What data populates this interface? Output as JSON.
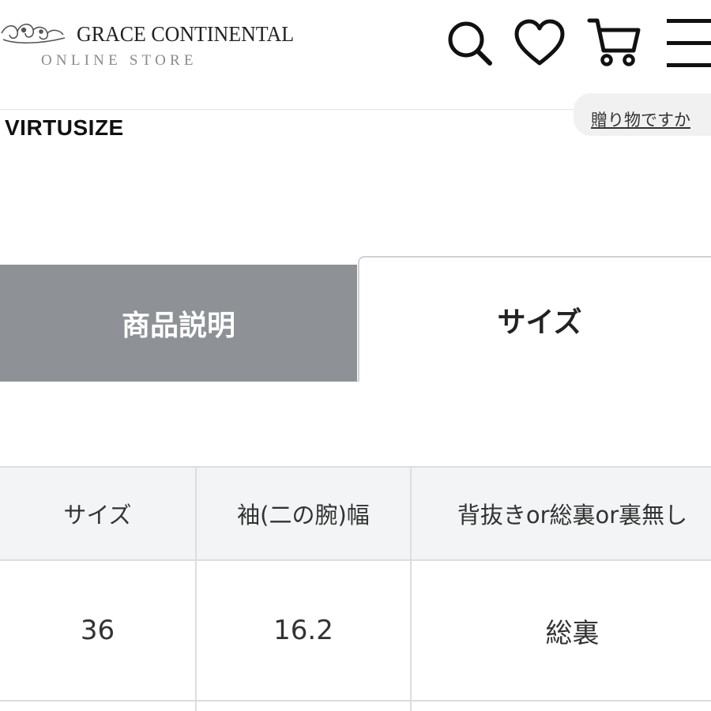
{
  "header": {
    "brand_name": "GRACE CONTINENTAL",
    "brand_sub": "ONLINE STORE",
    "icons": [
      "search-icon",
      "heart-icon",
      "cart-icon",
      "menu-icon"
    ]
  },
  "virtusize": {
    "label": "VIRTUSIZE"
  },
  "gift_link": {
    "label": "贈り物ですか"
  },
  "tabs": [
    {
      "label": "商品説明",
      "active": false
    },
    {
      "label": "サイズ",
      "active": true
    }
  ],
  "size_table": {
    "headers": [
      "サイズ",
      "袖(二の腕)幅",
      "背抜きor総裏or裏無し"
    ],
    "rows": [
      [
        "36",
        "16.2",
        "総裏"
      ]
    ]
  },
  "colors": {
    "inactive_tab": "#8e9196",
    "table_header_bg": "#f3f4f5",
    "border": "#dcdde0",
    "text": "#333333"
  }
}
